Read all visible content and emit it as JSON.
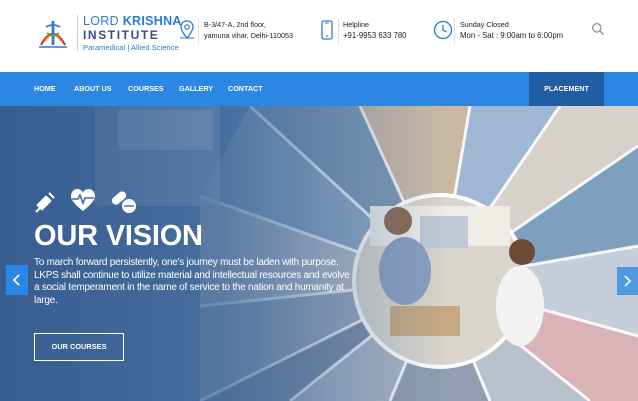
{
  "logo": {
    "line1_light": "LORD ",
    "line1_bold": "KRISHNA",
    "line2": "INSTITUTE",
    "line3": "Paramedical | Allied Science"
  },
  "header": {
    "address": {
      "line1": "B-3/47-A, 2nd floor,",
      "line2": "yamuna vihar, Delhi-110053",
      "icon": "map-pin-icon"
    },
    "helpline": {
      "label": "Helpline",
      "value": "+91-9953 633 780",
      "icon": "phone-icon"
    },
    "hours": {
      "label": "Sunday Closed",
      "value": "Mon - Sat : 9:00am to 6:00pm",
      "icon": "clock-icon"
    },
    "search_icon": "search-icon"
  },
  "nav": {
    "items": [
      {
        "label": "HOME"
      },
      {
        "label": "ABOUT US"
      },
      {
        "label": "COURSES"
      },
      {
        "label": "GALLERY"
      },
      {
        "label": "CONTACT"
      }
    ],
    "placement": "PLACEMENT"
  },
  "hero": {
    "icons": [
      "syringe-icon",
      "heartbeat-icon",
      "pills-icon"
    ],
    "title": "OUR VISION",
    "text": "To march forward persistently, one's journey must be laden with purpose. LKPS shall continue to utilize material and intellectual resources and evolve a social temperament in the name of service to the nation and humanity at large.",
    "button": "OUR COURSES",
    "prev_icon": "chevron-left-icon",
    "next_icon": "chevron-right-icon"
  },
  "colors": {
    "nav_blue": "#2b87e3",
    "placement_blue": "#205da3",
    "brand_blue": "#2b7bd2"
  }
}
